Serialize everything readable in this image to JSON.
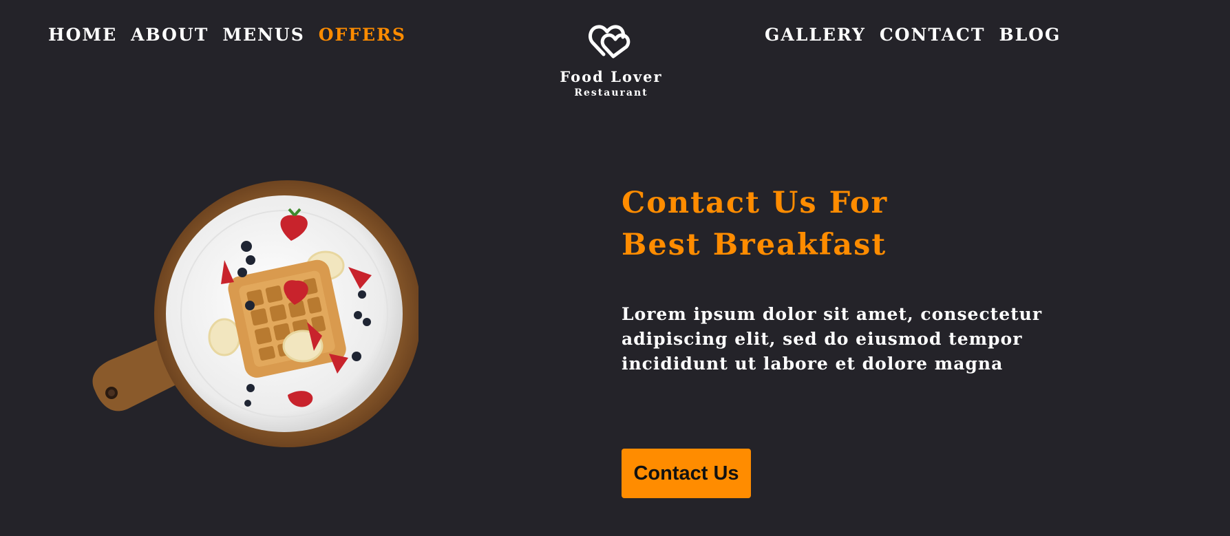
{
  "nav": {
    "left": [
      {
        "label": "HOME"
      },
      {
        "label": "ABOUT"
      },
      {
        "label": "MENUS"
      },
      {
        "label": "OFFERS"
      }
    ],
    "right": [
      {
        "label": "GALLERY"
      },
      {
        "label": "CONTACT"
      },
      {
        "label": "BLOG"
      }
    ]
  },
  "logo": {
    "icon": "double-heart-icon",
    "name": "Food Lover",
    "subtitle": "Restaurant"
  },
  "hero": {
    "image": "waffle-plate-illustration",
    "title_line1": "Contact Us For",
    "title_line2": "Best Breakfast",
    "text": "Lorem ipsum dolor sit amet, consectetur adipiscing elit, sed do eiusmod tempor incididunt ut labore et dolore magna",
    "cta_label": "Contact Us"
  },
  "colors": {
    "background": "#242329",
    "accent": "#ff8c00",
    "text": "#ffffff"
  }
}
